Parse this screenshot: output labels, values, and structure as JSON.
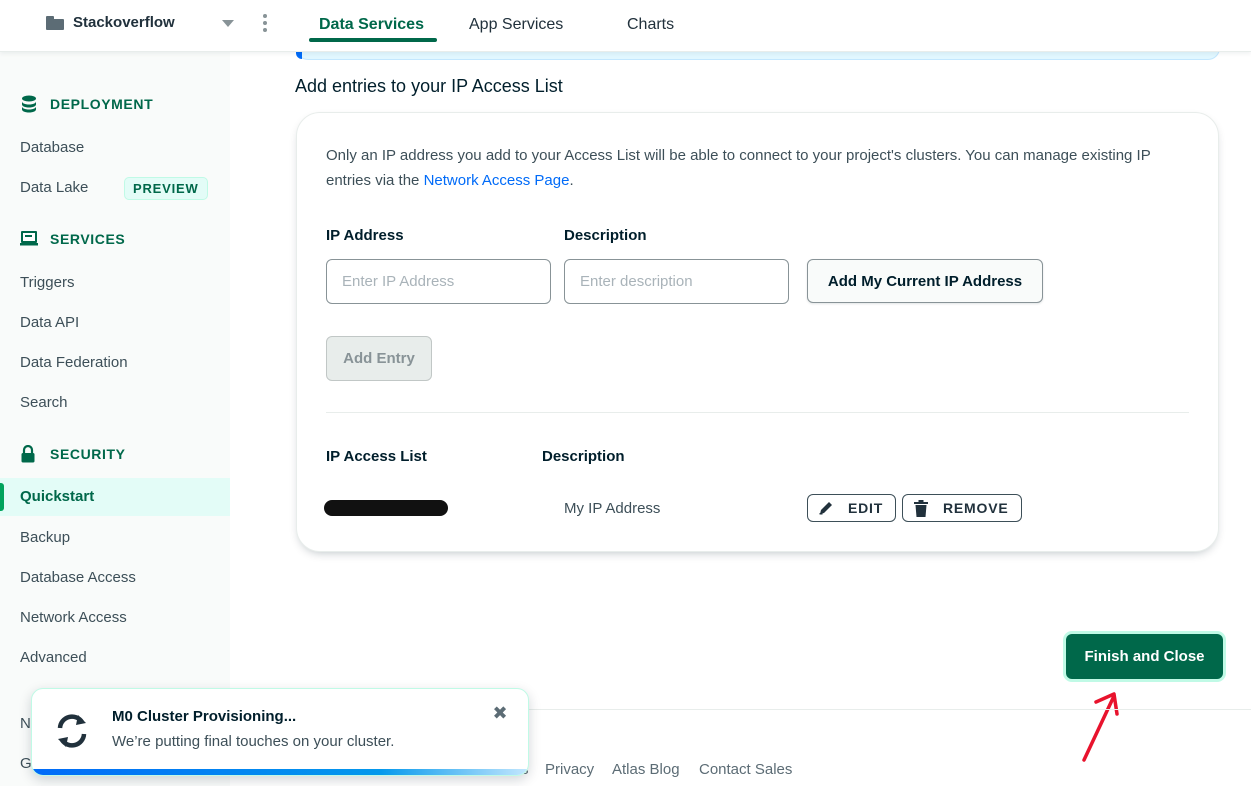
{
  "topbar": {
    "project_name": "Stackoverflow",
    "tabs": [
      {
        "label": "Data Services",
        "active": true
      },
      {
        "label": "App Services",
        "active": false
      },
      {
        "label": "Charts",
        "active": false
      }
    ]
  },
  "sidebar": {
    "deployment": {
      "heading": "DEPLOYMENT",
      "items": [
        "Database",
        "Data Lake"
      ],
      "data_lake_badge": "PREVIEW"
    },
    "services": {
      "heading": "SERVICES",
      "items": [
        "Triggers",
        "Data API",
        "Data Federation",
        "Search"
      ]
    },
    "security": {
      "heading": "SECURITY",
      "active_item": "Quickstart",
      "items": [
        "Backup",
        "Database Access",
        "Network Access",
        "Advanced"
      ]
    },
    "peek_items": [
      "N",
      "G"
    ]
  },
  "main": {
    "title": "Add entries to your IP Access List",
    "intro_text": "Only an IP address you add to your Access List will be able to connect to your project's clusters. You can manage existing IP entries via the ",
    "intro_link": "Network Access Page",
    "intro_end": ".",
    "form": {
      "ip_label": "IP Address",
      "ip_placeholder": "Enter IP Address",
      "desc_label": "Description",
      "desc_placeholder": "Enter description",
      "add_current_ip": "Add My Current IP Address",
      "add_entry": "Add Entry"
    },
    "access_list": {
      "col_ip": "IP Access List",
      "col_desc": "Description",
      "rows": [
        {
          "ip": "",
          "description": "My IP Address",
          "edit": "EDIT",
          "remove": "REMOVE"
        }
      ]
    },
    "finish_button": "Finish and Close"
  },
  "footer": {
    "links": [
      "s",
      "Privacy",
      "Atlas Blog",
      "Contact Sales"
    ]
  },
  "toast": {
    "title": "M0 Cluster Provisioning...",
    "body": "We’re putting final touches on your cluster.",
    "close": "✖"
  },
  "colors": {
    "brand_green": "#00684a",
    "link_blue": "#016bf8",
    "annotation_red": "#e8132d"
  }
}
